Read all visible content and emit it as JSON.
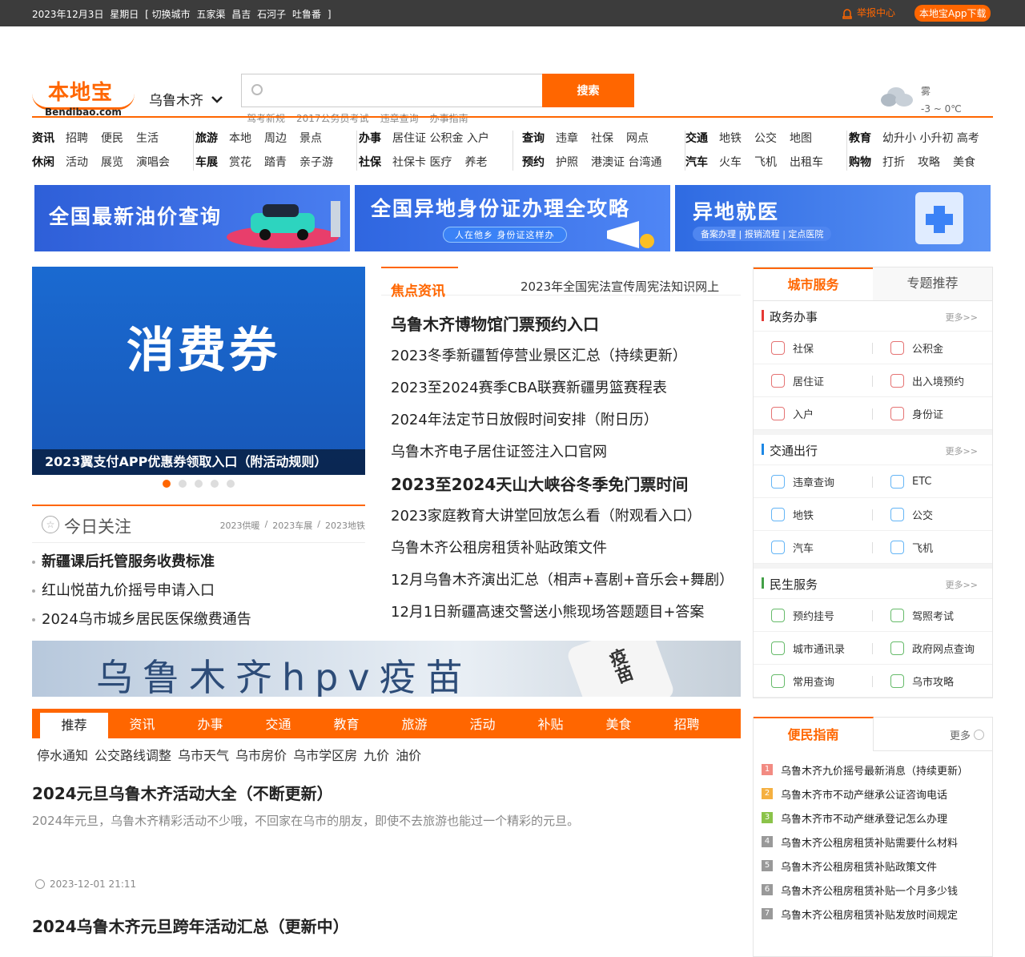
{
  "topbar": {
    "date": "2023年12月3日",
    "weekday": "星期日",
    "switch": "[ 切换城市",
    "cities": [
      "五家渠",
      "昌吉",
      "石河子",
      "吐鲁番"
    ],
    "close": "]",
    "report": "举报中心",
    "app": "本地宝App下载"
  },
  "header": {
    "logo_cn": "本地宝",
    "logo_en": "Bendibao.com",
    "city": "乌鲁木齐",
    "search_button": "搜索",
    "search_placeholder": "",
    "hotwords": [
      "驾考新规",
      "2017公务员考试",
      "违章查询",
      "办事指南"
    ],
    "weather": {
      "condition": "雾",
      "temp": "-3 ~ 0℃"
    }
  },
  "nav": [
    {
      "rows": [
        [
          "资讯",
          "招聘",
          "便民",
          "生活"
        ],
        [
          "休闲",
          "活动",
          "展览",
          "演唱会"
        ]
      ]
    },
    {
      "rows": [
        [
          "旅游",
          "本地",
          "周边",
          "景点"
        ],
        [
          "车展",
          "赏花",
          "踏青",
          "亲子游"
        ]
      ]
    },
    {
      "rows": [
        [
          "办事",
          "居住证 公积金 入户"
        ],
        [
          "社保",
          "社保卡 医疗",
          "养老"
        ]
      ]
    },
    {
      "rows": [
        [
          "查询",
          "违章",
          "社保",
          "网点"
        ],
        [
          "预约",
          "护照",
          "港澳证 台湾通"
        ]
      ]
    },
    {
      "rows": [
        [
          "交通",
          "地铁",
          "公交",
          "地图"
        ],
        [
          "汽车",
          "火车",
          "飞机",
          "出租车"
        ]
      ]
    },
    {
      "rows": [
        [
          "教育",
          "幼升小 小升初 高考"
        ],
        [
          "购物",
          "打折",
          "攻略",
          "美食"
        ]
      ]
    }
  ],
  "banners": [
    {
      "title": "全国最新油价查询",
      "sub": ""
    },
    {
      "title": "全国异地身份证办理全攻略",
      "sub": "人在他乡 身份证这样办"
    },
    {
      "title": "异地就医",
      "sub": "备案办理 | 报销流程 | 定点医院"
    }
  ],
  "slider": {
    "image_text": "消费券",
    "caption": "2023翼支付APP优惠券领取入口（附活动规则）"
  },
  "today": {
    "title": "今日关注",
    "links": [
      "2023供暖",
      "/",
      "2023车展",
      "/",
      "2023地铁"
    ],
    "items": [
      {
        "text": "新疆课后托管服务收费标准",
        "bold": true
      },
      {
        "text": "红山悦苗九价摇号申请入口",
        "bold": false
      },
      {
        "text": "2024乌市城乡居民医保缴费通告",
        "bold": false
      }
    ]
  },
  "focus": {
    "title": "焦点资讯",
    "marquee": "2023年全国宪法宣传周宪法知识网上",
    "news": [
      {
        "text": "乌鲁木齐博物馆门票预约入口",
        "bold": true
      },
      {
        "text": "2023冬季新疆暂停营业景区汇总（持续更新）",
        "bold": false
      },
      {
        "text": "2023至2024赛季CBA联赛新疆男篮赛程表",
        "bold": false
      },
      {
        "text": "2024年法定节日放假时间安排（附日历）",
        "bold": false
      },
      {
        "text": "乌鲁木齐电子居住证签注入口官网",
        "bold": false
      },
      {
        "text": "2023至2024天山大峡谷冬季免门票时间",
        "bold": true
      },
      {
        "text": "2023家庭教育大讲堂回放怎么看（附观看入口）",
        "bold": false
      },
      {
        "text": "乌鲁木齐公租房租赁补贴政策文件",
        "bold": false
      },
      {
        "text": "12月乌鲁木齐演出汇总（相声+喜剧+音乐会+舞剧）",
        "bold": false
      },
      {
        "text": "12月1日新疆高速交警送小熊现场答题题目+答案",
        "bold": false
      }
    ]
  },
  "hpv": {
    "text": "乌鲁木齐hpv疫苗",
    "bottle": "疫苗"
  },
  "tabs": [
    "推荐",
    "资讯",
    "办事",
    "交通",
    "教育",
    "旅游",
    "活动",
    "补贴",
    "美食",
    "招聘"
  ],
  "tags": [
    "停水通知",
    "公交路线调整",
    "乌市天气",
    "乌市房价",
    "乌市学区房",
    "九价",
    "油价"
  ],
  "articles": [
    {
      "title": "2024元旦乌鲁木齐活动大全（不断更新）",
      "desc": "2024年元旦，乌鲁木齐精彩活动不少哦，不回家在乌市的朋友，即使不去旅游也能过一个精彩的元旦。",
      "time": "2023-12-01 21:11"
    },
    {
      "title": "2024乌鲁木齐元旦跨年活动汇总（更新中）",
      "desc": "",
      "time": ""
    }
  ],
  "right": {
    "tabs": [
      "城市服务",
      "专题推荐"
    ],
    "sections": [
      {
        "title": "政务办事",
        "more": "更多>>",
        "color": "#e53935",
        "items": [
          {
            "label": "社保",
            "icon": "shebao-icon",
            "color": "#e57373"
          },
          {
            "label": "公积金",
            "icon": "gongjijin-icon",
            "color": "#e57373"
          },
          {
            "label": "居住证",
            "icon": "home-icon",
            "color": "#e57373"
          },
          {
            "label": "出入境预约",
            "icon": "passport-icon",
            "color": "#e57373"
          },
          {
            "label": "入户",
            "icon": "form-icon",
            "color": "#e57373"
          },
          {
            "label": "身份证",
            "icon": "idcard-icon",
            "color": "#e57373"
          }
        ]
      },
      {
        "title": "交通出行",
        "more": "更多>>",
        "color": "#1e88e5",
        "items": [
          {
            "label": "违章查询",
            "icon": "violation-icon",
            "color": "#64b5f6"
          },
          {
            "label": "ETC",
            "icon": "etc-icon",
            "color": "#64b5f6"
          },
          {
            "label": "地铁",
            "icon": "metro-icon",
            "color": "#64b5f6"
          },
          {
            "label": "公交",
            "icon": "bus-icon",
            "color": "#64b5f6"
          },
          {
            "label": "汽车",
            "icon": "car-icon",
            "color": "#64b5f6"
          },
          {
            "label": "飞机",
            "icon": "plane-icon",
            "color": "#64b5f6"
          }
        ]
      },
      {
        "title": "民生服务",
        "more": "更多>>",
        "color": "#43a047",
        "items": [
          {
            "label": "预约挂号",
            "icon": "hospital-icon",
            "color": "#66bb6a"
          },
          {
            "label": "驾照考试",
            "icon": "clock-icon",
            "color": "#66bb6a"
          },
          {
            "label": "城市通讯录",
            "icon": "phone-icon",
            "color": "#66bb6a"
          },
          {
            "label": "政府网点查询",
            "icon": "doc-icon",
            "color": "#66bb6a"
          },
          {
            "label": "常用查询",
            "icon": "star-icon",
            "color": "#66bb6a"
          },
          {
            "label": "乌市攻略",
            "icon": "tag-icon",
            "color": "#66bb6a"
          }
        ]
      }
    ]
  },
  "guide": {
    "title": "便民指南",
    "more": "更多",
    "items": [
      {
        "n": "1",
        "text": "乌鲁木齐九价摇号最新消息（持续更新）",
        "color": "#f28b82"
      },
      {
        "n": "2",
        "text": "乌鲁木齐市不动产继承公证咨询电话",
        "color": "#f5b041"
      },
      {
        "n": "3",
        "text": "乌鲁木齐市不动产继承登记怎么办理",
        "color": "#8bc34a"
      },
      {
        "n": "4",
        "text": "乌鲁木齐公租房租赁补贴需要什么材料",
        "color": "#999999"
      },
      {
        "n": "5",
        "text": "乌鲁木齐公租房租赁补贴政策文件",
        "color": "#999999"
      },
      {
        "n": "6",
        "text": "乌鲁木齐公租房租赁补贴一个月多少钱",
        "color": "#999999"
      },
      {
        "n": "7",
        "text": "乌鲁木齐公租房租赁补贴发放时间规定",
        "color": "#999999"
      }
    ]
  }
}
